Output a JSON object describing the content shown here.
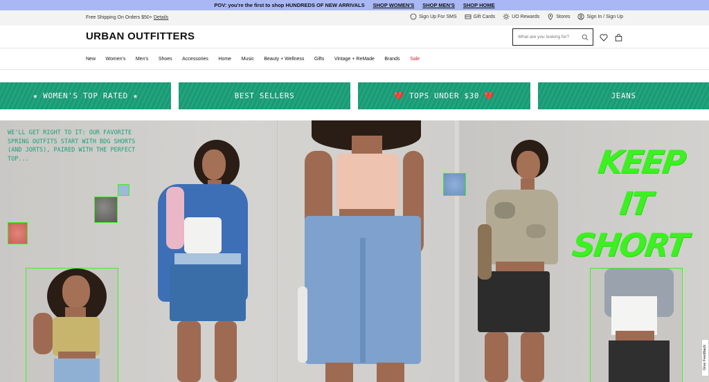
{
  "promo_bar": {
    "message": "POV: you're the first to shop HUNDREDS OF NEW ARRIVALS",
    "links": [
      "SHOP WOMEN'S",
      "SHOP MEN'S",
      "SHOP HOME"
    ]
  },
  "utility_bar": {
    "shipping": "Free Shipping On Orders $50+",
    "details": "Details",
    "sms": "Sign Up For SMS",
    "gift_cards": "Gift Cards",
    "rewards": "UO Rewards",
    "stores": "Stores",
    "account": "Sign In / Sign Up"
  },
  "header": {
    "logo": "URBAN OUTFITTERS",
    "search_placeholder": "What are you looking for?"
  },
  "nav": {
    "items": [
      "New",
      "Women's",
      "Men's",
      "Shoes",
      "Accessories",
      "Home",
      "Music",
      "Beauty + Wellness",
      "Gifts",
      "Vintage + ReMade",
      "Brands",
      "Sale"
    ]
  },
  "tiles": [
    "★ WOMEN'S TOP RATED ★",
    "BEST SELLERS",
    "❤️ TOPS UNDER $30 ❤️",
    "JEANS"
  ],
  "hero": {
    "text": "WE'LL GET RIGHT TO IT: OUR FAVORITE SPRING OUTFITS START WITH BDG SHORTS (AND JORTS), PAIRED WITH THE PERFECT TOP...",
    "headline_line1": "KEEP IT",
    "headline_line2": "SHORT"
  },
  "feedback": "Give Feedback",
  "colors": {
    "promo_bg": "#a9b7f5",
    "tile_green": "#1a9f79",
    "neon_green": "#3cf022",
    "sale_red": "#d2232a"
  }
}
